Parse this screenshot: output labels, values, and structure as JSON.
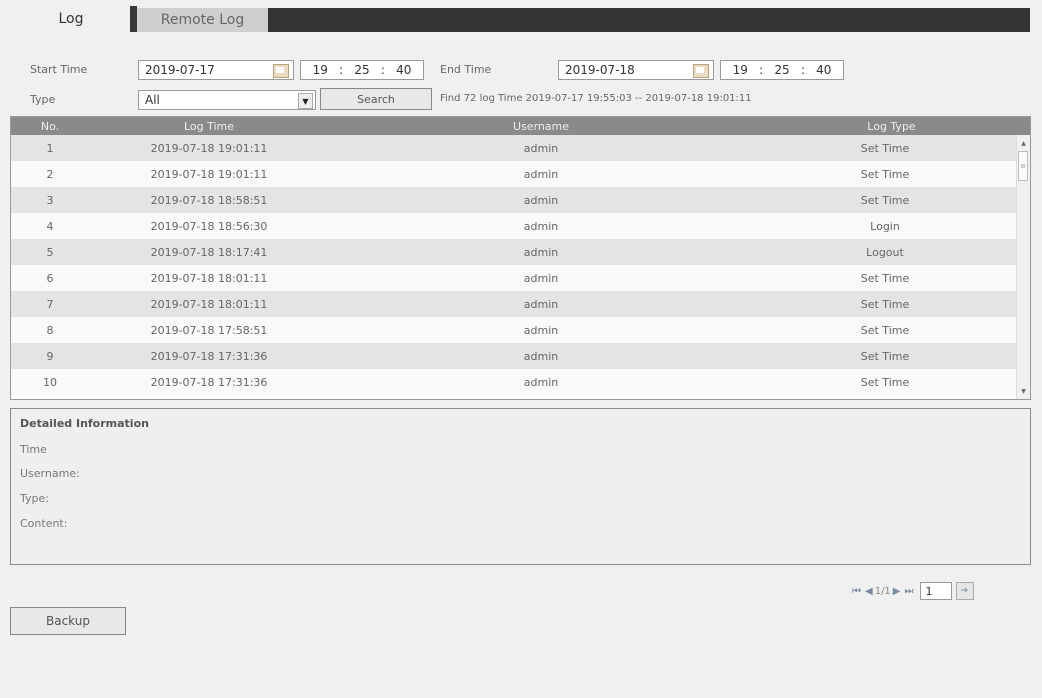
{
  "tabs": {
    "log": "Log",
    "remote_log": "Remote Log"
  },
  "filters": {
    "start_time_label": "Start Time",
    "start_date": "2019-07-17",
    "start_h": "19",
    "start_m": "25",
    "start_s": "40",
    "end_time_label": "End Time",
    "end_date": "2019-07-18",
    "end_h": "19",
    "end_m": "25",
    "end_s": "40",
    "time_sep": ":",
    "type_label": "Type",
    "type_value": "All",
    "search_label": "Search",
    "result_text": "Find 72 log Time 2019-07-17 19:55:03 -- 2019-07-18 19:01:11"
  },
  "table": {
    "headers": [
      "No.",
      "Log Time",
      "Username",
      "Log Type"
    ],
    "rows": [
      [
        "1",
        "2019-07-18 19:01:11",
        "admin",
        "Set Time"
      ],
      [
        "2",
        "2019-07-18 19:01:11",
        "admin",
        "Set Time"
      ],
      [
        "3",
        "2019-07-18 18:58:51",
        "admin",
        "Set Time"
      ],
      [
        "4",
        "2019-07-18 18:56:30",
        "admin",
        "Login"
      ],
      [
        "5",
        "2019-07-18 18:17:41",
        "admin",
        "Logout"
      ],
      [
        "6",
        "2019-07-18 18:01:11",
        "admin",
        "Set Time"
      ],
      [
        "7",
        "2019-07-18 18:01:11",
        "admin",
        "Set Time"
      ],
      [
        "8",
        "2019-07-18 17:58:51",
        "admin",
        "Set Time"
      ],
      [
        "9",
        "2019-07-18 17:31:36",
        "admin",
        "Set Time"
      ],
      [
        "10",
        "2019-07-18 17:31:36",
        "admin",
        "Set Time"
      ]
    ]
  },
  "details": {
    "title": "Detailed Information",
    "time": "Time",
    "username": "Username:",
    "type": "Type:",
    "content": "Content:"
  },
  "pager": {
    "page_info": "1/1",
    "page_input": "1"
  },
  "backup_label": "Backup",
  "colors": {
    "header_bg": "#8a8a8a",
    "tab_dark": "#333333",
    "row_odd": "#e4e4e4",
    "row_even": "#f9f9f9"
  }
}
